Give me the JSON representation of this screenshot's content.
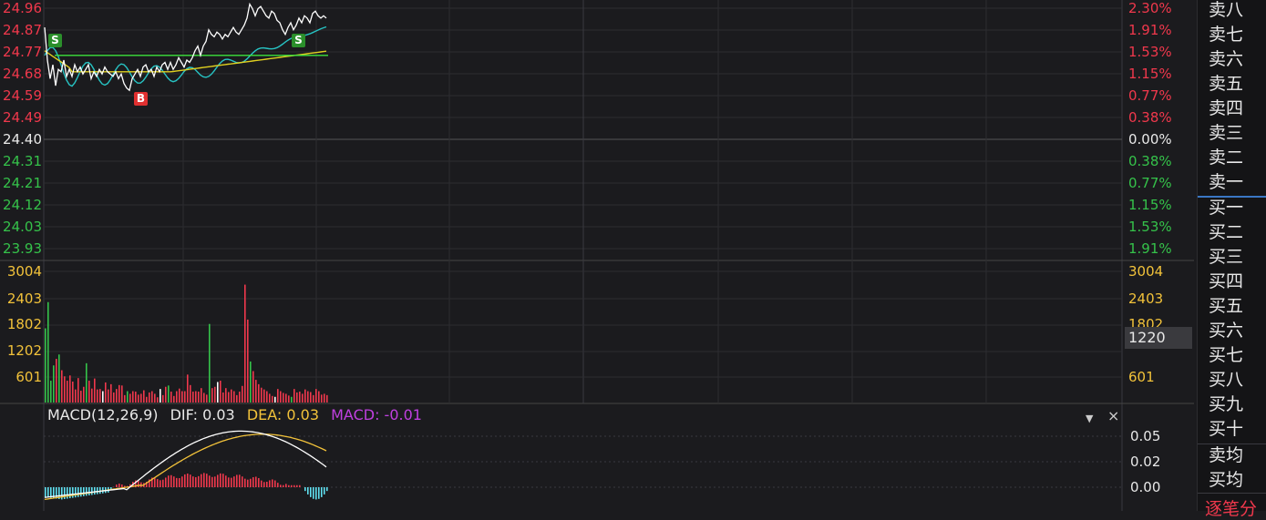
{
  "price_axis_left": [
    {
      "text": "24.96",
      "tone": "red"
    },
    {
      "text": "24.87",
      "tone": "red"
    },
    {
      "text": "24.77",
      "tone": "red"
    },
    {
      "text": "24.68",
      "tone": "red"
    },
    {
      "text": "24.59",
      "tone": "red"
    },
    {
      "text": "24.49",
      "tone": "red"
    },
    {
      "text": "24.40",
      "tone": "white"
    },
    {
      "text": "24.31",
      "tone": "green"
    },
    {
      "text": "24.21",
      "tone": "green"
    },
    {
      "text": "24.12",
      "tone": "green"
    },
    {
      "text": "24.03",
      "tone": "green"
    },
    {
      "text": "23.93",
      "tone": "green"
    }
  ],
  "pct_axis_right": [
    {
      "text": "2.30%",
      "tone": "red"
    },
    {
      "text": "1.91%",
      "tone": "red"
    },
    {
      "text": "1.53%",
      "tone": "red"
    },
    {
      "text": "1.15%",
      "tone": "red"
    },
    {
      "text": "0.77%",
      "tone": "red"
    },
    {
      "text": "0.38%",
      "tone": "red"
    },
    {
      "text": "0.00%",
      "tone": "white"
    },
    {
      "text": "0.38%",
      "tone": "green"
    },
    {
      "text": "0.77%",
      "tone": "green"
    },
    {
      "text": "1.15%",
      "tone": "green"
    },
    {
      "text": "1.53%",
      "tone": "green"
    },
    {
      "text": "1.91%",
      "tone": "green"
    }
  ],
  "volume_axis_left": [
    "3004",
    "2403",
    "1802",
    "1202",
    "601"
  ],
  "volume_axis_right": [
    "3004",
    "2403",
    "1802",
    "1202",
    "601"
  ],
  "volume_cursor_value": "1220",
  "macd": {
    "title": "MACD(12,26,9)",
    "dif": "DIF: 0.03",
    "dea": "DEA: 0.03",
    "macd": "MACD: -0.01",
    "axis": [
      "0.05",
      "0.02",
      "0.00"
    ]
  },
  "markers": {
    "sell1": "S",
    "sell2": "S",
    "buy1": "B"
  },
  "order_book": {
    "sell": [
      "卖八",
      "卖七",
      "卖六",
      "卖五",
      "卖四",
      "卖三",
      "卖二",
      "卖一"
    ],
    "buy": [
      "买一",
      "买二",
      "买三",
      "买四",
      "买五",
      "买六",
      "买七",
      "买八",
      "买九",
      "买十"
    ],
    "avg": [
      "卖均",
      "买均"
    ],
    "footer": "逐笔分"
  },
  "icons": {
    "dropdown": "▼",
    "close": "×"
  },
  "colors": {
    "up": "#f0384c",
    "down": "#35c24a",
    "price_line": "#ffffff",
    "avg_line": "#e0d020",
    "teal_line": "#27c3c3",
    "ma_green": "#3de43d",
    "dea": "#f2c23a",
    "macd": "#c040e0"
  }
}
